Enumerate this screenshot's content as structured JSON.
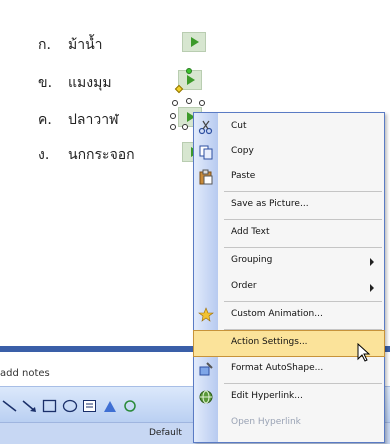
{
  "slide": {
    "questions": [
      {
        "letter": "ก.",
        "word": "ม้าน้ำ"
      },
      {
        "letter": "ข.",
        "word": "แมงมุม"
      },
      {
        "letter": "ค.",
        "word": "ปลาวาฬ"
      },
      {
        "letter": "ง.",
        "word": "นกกระจอก"
      }
    ]
  },
  "notes": {
    "placeholder": "add notes"
  },
  "status_bar": {
    "design": "Default"
  },
  "context_menu": {
    "items": [
      {
        "label": "Cut",
        "icon": "scissors-icon"
      },
      {
        "label": "Copy",
        "icon": "copy-icon"
      },
      {
        "label": "Paste",
        "icon": "clipboard-icon"
      },
      {
        "label": "Save as Picture..."
      },
      {
        "label": "Add Text"
      },
      {
        "label": "Grouping",
        "submenu": true
      },
      {
        "label": "Order",
        "submenu": true
      },
      {
        "label": "Custom Animation...",
        "icon": "star-animation-icon"
      },
      {
        "label": "Action Settings...",
        "highlighted": true
      },
      {
        "label": "Format AutoShape...",
        "icon": "format-shape-icon"
      },
      {
        "label": "Edit Hyperlink...",
        "icon": "hyperlink-icon"
      },
      {
        "label": "Open Hyperlink",
        "disabled": true
      }
    ]
  },
  "colors": {
    "accent": "#3a5fa8",
    "highlight": "#fbe39a",
    "play": "#3c9a2a"
  }
}
